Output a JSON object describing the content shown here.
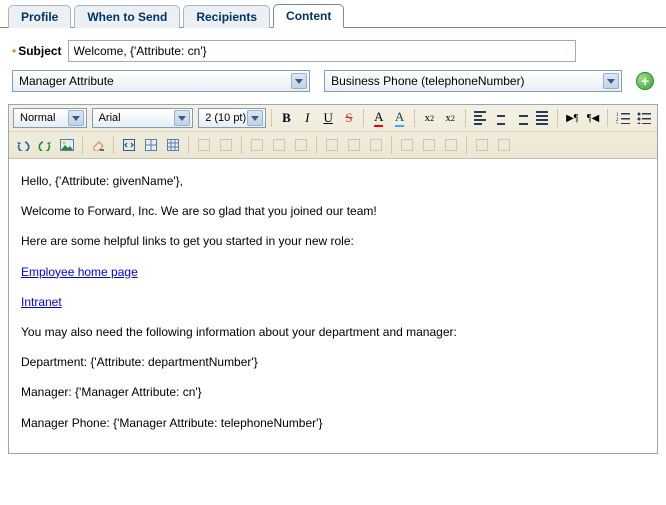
{
  "tabs": [
    "Profile",
    "When to Send",
    "Recipients",
    "Content"
  ],
  "active_tab": 3,
  "subject": {
    "label": "Subject",
    "value": "Welcome, {'Attribute: cn'}"
  },
  "dropdowns": {
    "left": "Manager Attribute",
    "right": "Business Phone (telephoneNumber)"
  },
  "toolbar": {
    "para": "Normal",
    "font": "Arial",
    "size": "2 (10 pt)"
  },
  "body": {
    "p1": "Hello, {'Attribute: givenName'},",
    "p2": "Welcome to Forward, Inc. We are so glad that you joined our team!",
    "p3": "Here are some helpful links to get you started in your new role:",
    "link1": "Employee home page",
    "link2": "Intranet",
    "p4": "You may also need the following information about your department and manager:",
    "p5": "Department: {'Attribute: departmentNumber'}",
    "p6": "Manager: {'Manager Attribute: cn'}",
    "p7": "Manager Phone: {'Manager Attribute: telephoneNumber'}"
  }
}
